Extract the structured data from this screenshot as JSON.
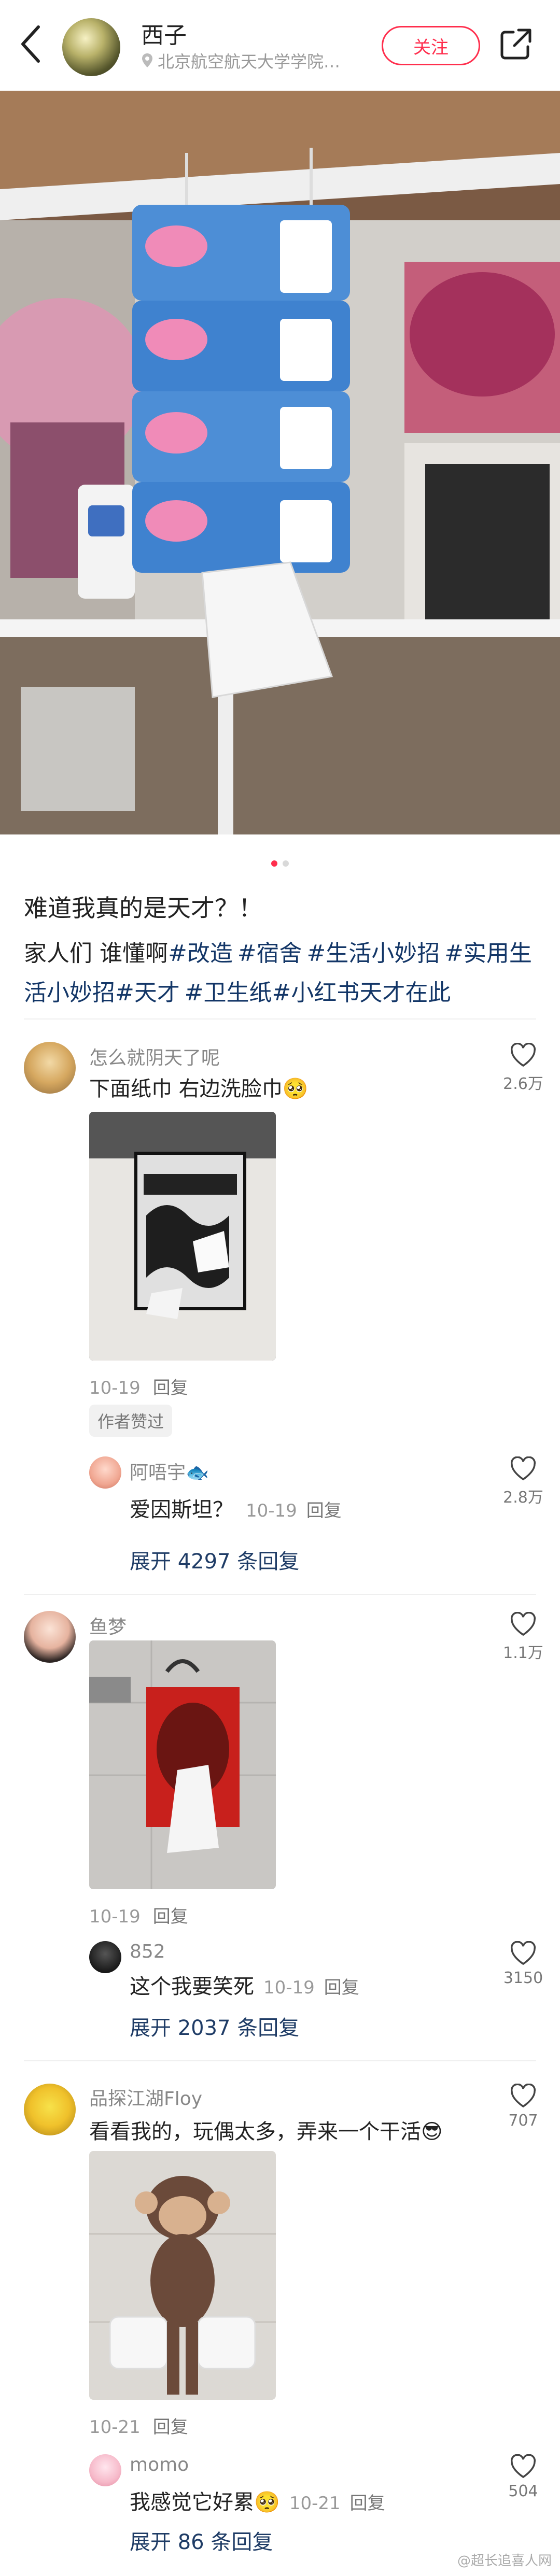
{
  "header": {
    "author": "西子",
    "location": "北京航空航天大学学院…",
    "follow_label": "关注"
  },
  "post": {
    "title": "难道我真的是天才？！",
    "intro": "家人们 谁懂啊",
    "tags": [
      "#改造",
      "#宿舍",
      "#生活小妙招",
      "#实用生活小妙招",
      "#天才",
      "#卫生纸",
      "#小红书天才在此"
    ]
  },
  "comments": [
    {
      "name": "怎么就阴天了呢",
      "text": "下面纸巾 右边洗脸巾",
      "text_emoji": "🥺",
      "date": "10-19",
      "reply_label": "回复",
      "likes": "2.6万",
      "author_liked": "作者赞过",
      "reply": {
        "name": "阿唔宇",
        "name_emoji": "🐟",
        "text": "爱因斯坦？",
        "date": "10-19",
        "reply_label": "回复",
        "likes": "2.8万"
      },
      "expand": "展开 4297 条回复"
    },
    {
      "name": "鱼梦",
      "text": "",
      "date": "10-19",
      "reply_label": "回复",
      "likes": "1.1万",
      "reply": {
        "name": "852",
        "text": "这个我要笑死",
        "date": "10-19",
        "reply_label": "回复",
        "likes": "3150"
      },
      "expand": "展开 2037 条回复"
    },
    {
      "name": "品探江湖Floy",
      "text": "看看我的，玩偶太多，弄来一个干活",
      "text_emoji": "😎",
      "date": "10-21",
      "reply_label": "回复",
      "likes": "707",
      "reply": {
        "name": "momo",
        "text": "我感觉它好累",
        "text_emoji": "🥺",
        "date": "10-21",
        "reply_label": "回复",
        "likes": "504"
      },
      "expand": "展开 86 条回复"
    }
  ],
  "watermark": "@超长追喜人网",
  "colors": {
    "accent": "#ff2e4d",
    "tag": "#133667",
    "muted": "#999999"
  }
}
